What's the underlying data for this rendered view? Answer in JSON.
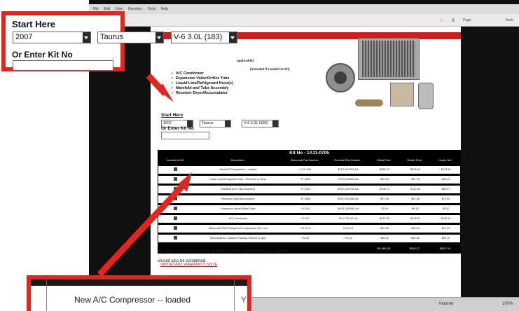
{
  "browser": {
    "menu": [
      "File",
      "Edit",
      "View",
      "Favorites",
      "Tools",
      "Help"
    ],
    "toolbar_page_label": "Page",
    "toolbar_tools_label": "Tools",
    "status_text": "Internet",
    "status_zoom": "100%"
  },
  "page": {
    "kit_items": [
      "A/C Condenser",
      "Expansion Valve/Orifice Tube",
      "Liquid Line/Refrigerant Hose(s)",
      "Manifold and Tube Assembly",
      "Receiver Dryer/Accumulator"
    ],
    "kit_intro_suffix": "applicable):",
    "kit_intro_note": "(included if Loaded in Kit)",
    "selector": {
      "label": "Start Here",
      "year": "2007",
      "model": "Taurus",
      "engine": "V-6 3.0L (183)",
      "kit_label": "Or Enter Kit No"
    },
    "kit_table": {
      "title": "Kit No - 1A11-0705",
      "headers": [
        "Included in Kit",
        "Description",
        "Motorcraft Part Number",
        "Genuine Part Number",
        "Retail Price",
        "Dealer Price",
        "Dealer Net"
      ],
      "rows": [
        {
          "desc": "New A/C Compressor -- loaded",
          "mpn": "YCC-346",
          "gpn": "4F1Z-19V703-AA",
          "retail": "$385.23",
          "dealer": "$336.68",
          "net": "$273.59"
        },
        {
          "desc": "Liquid Line/Refrigerant Hose - Receiver to Evap.",
          "mpn": "YF-3293",
          "gpn": "7F1Z-19D850-AA",
          "retail": "$59.63",
          "dealer": "$52.78",
          "net": "$46.93"
        },
        {
          "desc": "Manifold and Tube Assembly",
          "mpn": "YF-2423",
          "gpn": "4F1Z-19D734-AA",
          "retail": "$108.71",
          "dealer": "$112.30",
          "net": "$89.57"
        },
        {
          "desc": "Receiver Dryer/Accumulator",
          "mpn": "YF-3098",
          "gpn": "4F1Z-19C836-AA",
          "retail": "$97.26",
          "dealer": "$63.96",
          "net": "$73.52"
        },
        {
          "desc": "Expansion Valve/Orifice Tube",
          "mpn": "YG-242",
          "gpn": "3W1Z-19D990-AA",
          "retail": "$7.84",
          "dealer": "$6.18",
          "net": "$5.52"
        },
        {
          "desc": "A/C Condenser",
          "mpn": "YJ-477",
          "gpn": "4F1Z-19712-AA",
          "retail": "$272.23",
          "dealer": "$238.20",
          "net": "$192.54"
        },
        {
          "desc": "Motorcraft PAG Refrigerant Compressor Oil (7 oz)",
          "mpn": "YN-12-D",
          "gpn": "YN-12-D",
          "retail": "$20.48",
          "dealer": "$15.64",
          "net": "$14.29"
        },
        {
          "desc": "Motorcraft A/C System Flushing Solvent (1 gal.)",
          "mpn": "YN-23",
          "gpn": "YN-23",
          "retail": "$36.10",
          "dealer": "$30.35",
          "net": "$25.10"
        }
      ],
      "totals": {
        "retail": "$1,064.26",
        "dealer": "$910.27",
        "net": "$813.76"
      }
    },
    "warranty_link": "IMPORTANT WARRANTY NOTE",
    "body_line1": "ters after compressor failure or other system contamination, in addition",
    "body_line2": "should also be completed."
  },
  "callout_top": {
    "label": "Start Here",
    "year": "2007",
    "model": "Taurus",
    "engine": "V-6 3.0L (183)",
    "kit_label": "Or Enter Kit No"
  },
  "callout_bottom": {
    "row_text": "New A/C Compressor -- loaded",
    "cut_off_text": "Y"
  },
  "colors": {
    "accent_red": "#e2261f",
    "page_black": "#101010",
    "header_red": "#d21b1b"
  }
}
